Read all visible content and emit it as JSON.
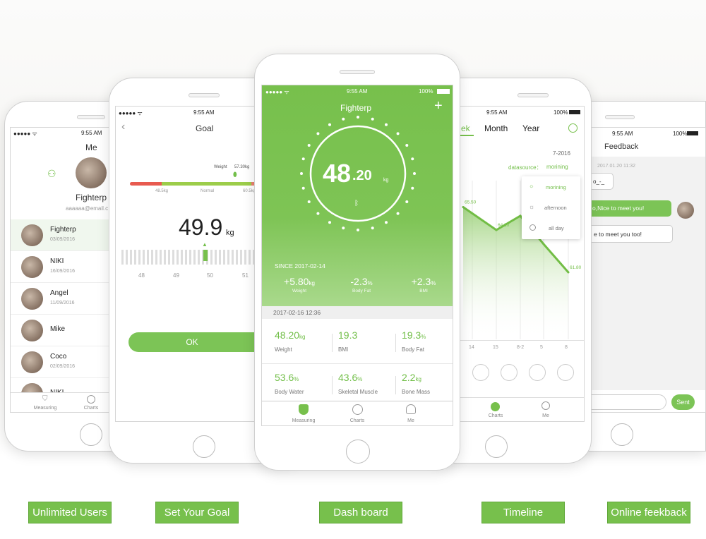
{
  "status_time": "9:55 AM",
  "battery": "100%",
  "colors": {
    "accent": "#77c04c",
    "danger": "#e85a4f"
  },
  "me_screen": {
    "title": "Me",
    "profile_name": "Fighterp",
    "profile_email": "aaaaaa@email.c",
    "users": [
      {
        "name": "Fighterp",
        "date": "03/09/2016"
      },
      {
        "name": "NIKI",
        "date": "16/09/2016"
      },
      {
        "name": "Angel",
        "date": "11/09/2016"
      },
      {
        "name": "Mike",
        "date": ""
      },
      {
        "name": "Coco",
        "date": "02/09/2016"
      },
      {
        "name": "NIKI",
        "date": ""
      }
    ],
    "tabs": [
      "Measuring",
      "Charts"
    ]
  },
  "goal_screen": {
    "title": "Goal",
    "weight_label": "Weight",
    "weight_value": "57.30kg",
    "range_low": "48.5kg",
    "range_mid": "Normal",
    "range_high": "60.5kg",
    "goal_value": "49.9",
    "goal_unit": "kg",
    "ruler_labels": [
      "48",
      "49",
      "50",
      "51"
    ],
    "ok": "OK"
  },
  "dashboard": {
    "title": "Fighterp",
    "weight_int": "48",
    "weight_dec": ".20",
    "weight_unit": "kg",
    "since": "SINCE 2017-02-14",
    "changes": [
      {
        "value": "+5.80",
        "unit": "kg",
        "label": "Weight"
      },
      {
        "value": "-2.3",
        "unit": "%",
        "label": "Body Fat"
      },
      {
        "value": "+2.3",
        "unit": "%",
        "label": "BMI"
      }
    ],
    "measure_time": "2017-02-16  12:36",
    "metrics": [
      {
        "value": "48.20",
        "unit": "kg",
        "label": "Weight"
      },
      {
        "value": "19.3",
        "unit": "",
        "label": "BMI"
      },
      {
        "value": "19.3",
        "unit": "%",
        "label": "Body Fat"
      },
      {
        "value": "53.6",
        "unit": "%",
        "label": "Body Water"
      },
      {
        "value": "43.6",
        "unit": "%",
        "label": "Skeletal Muscle"
      },
      {
        "value": "2.2",
        "unit": "kg",
        "label": "Bone Mass"
      }
    ],
    "tabs": [
      "Measuring",
      "Charts",
      "Me"
    ]
  },
  "timeline": {
    "tabs": [
      "ek",
      "Month",
      "Year"
    ],
    "period": "7-2016",
    "datasource_label": "datasource：",
    "datasource_value": "morining",
    "dropdown": [
      "morining",
      "afternoon",
      "all day"
    ],
    "tabs_bottom": [
      "Charts",
      "Me"
    ]
  },
  "chart_data": {
    "type": "area",
    "categories": [
      "14",
      "15",
      "8-2",
      "5",
      "8"
    ],
    "values": [
      65.5,
      64.2,
      65.0,
      null,
      61.8
    ],
    "point_labels": [
      "65.50",
      "64.20",
      "65.",
      "",
      "61.80"
    ],
    "ylim": [
      58,
      67
    ],
    "grid": true
  },
  "feedback": {
    "title": "Feedback",
    "timestamp": "2017.01.20  11:32",
    "messages": [
      {
        "text": "o_-_",
        "side": "left"
      },
      {
        "text": "o,Nice to meet you!",
        "side": "right"
      },
      {
        "text": "e to meet you too!",
        "side": "left"
      }
    ],
    "send": "Sent"
  },
  "captions": [
    "Unlimited Users",
    "Set Your Goal",
    "Dash board",
    "Timeline",
    "Online feekback"
  ]
}
